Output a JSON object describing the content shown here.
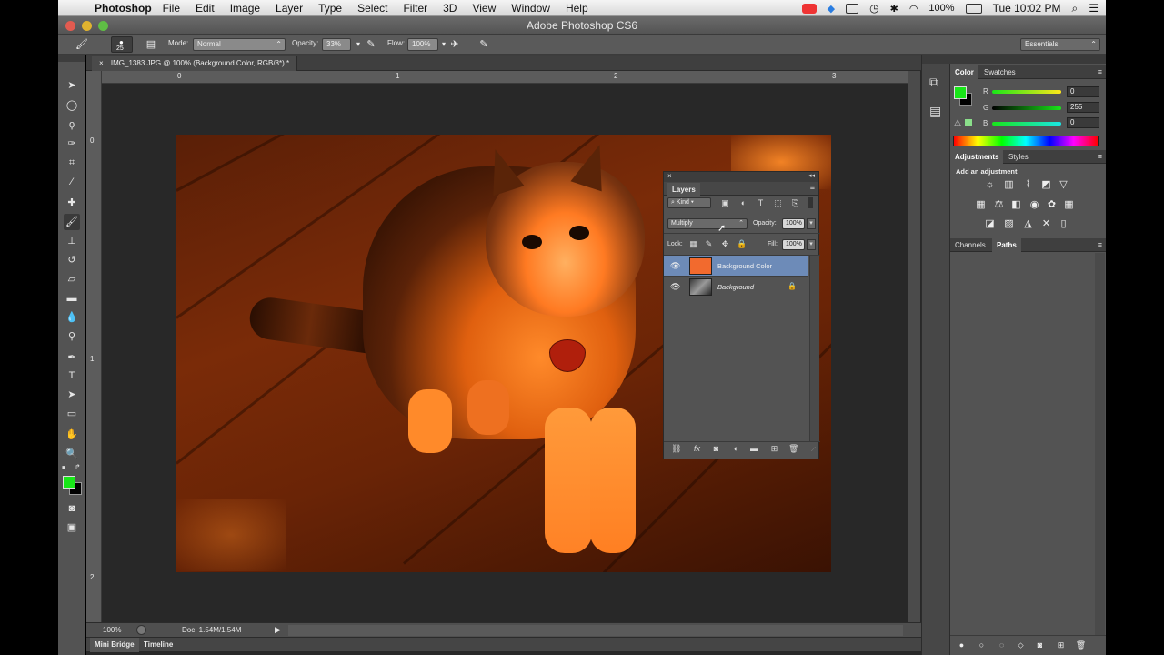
{
  "menubar": {
    "apple": "",
    "app_name": "Photoshop",
    "items": [
      "File",
      "Edit",
      "Image",
      "Layer",
      "Type",
      "Select",
      "Filter",
      "3D",
      "View",
      "Window",
      "Help"
    ],
    "battery": "100%",
    "clock": "Tue 10:02 PM"
  },
  "window": {
    "title": "Adobe Photoshop CS6"
  },
  "options": {
    "brush_size": "25",
    "mode_label": "Mode:",
    "mode_value": "Normal",
    "opacity_label": "Opacity:",
    "opacity_value": "33%",
    "flow_label": "Flow:",
    "flow_value": "100%",
    "workspace": "Essentials"
  },
  "document": {
    "tab_title": "IMG_1383.JPG @ 100% (Background Color, RGB/8*) *",
    "ruler_h": [
      "0",
      "1",
      "2",
      "3"
    ],
    "ruler_v": [
      "0",
      "1",
      "2"
    ],
    "zoom": "100%",
    "doc_info": "Doc: 1.54M/1.54M"
  },
  "bottom_tabs": [
    "Mini Bridge",
    "Timeline"
  ],
  "layers_panel": {
    "title": "Layers",
    "filter_kind": "Kind",
    "blend_mode": "Multiply",
    "opacity_label": "Opacity:",
    "opacity_value": "100%",
    "lock_label": "Lock:",
    "fill_label": "Fill:",
    "fill_value": "100%",
    "layers": [
      {
        "name": "Background Color",
        "selected": true,
        "thumb_color": "#f26a2e"
      },
      {
        "name": "Background",
        "selected": false,
        "locked": true
      }
    ]
  },
  "color_panel": {
    "tabs": [
      "Color",
      "Swatches"
    ],
    "channels": [
      {
        "label": "R",
        "value": "0"
      },
      {
        "label": "G",
        "value": "255"
      },
      {
        "label": "B",
        "value": "0"
      }
    ],
    "foreground": "#19e619",
    "background": "#000000"
  },
  "adjustments_panel": {
    "tabs": [
      "Adjustments",
      "Styles"
    ],
    "hint": "Add an adjustment"
  },
  "channels_panel": {
    "tabs": [
      "Channels",
      "Paths"
    ]
  },
  "colors": {
    "accent_selection": "#6d8bb8",
    "photo_tint": "#ff6a1a"
  }
}
